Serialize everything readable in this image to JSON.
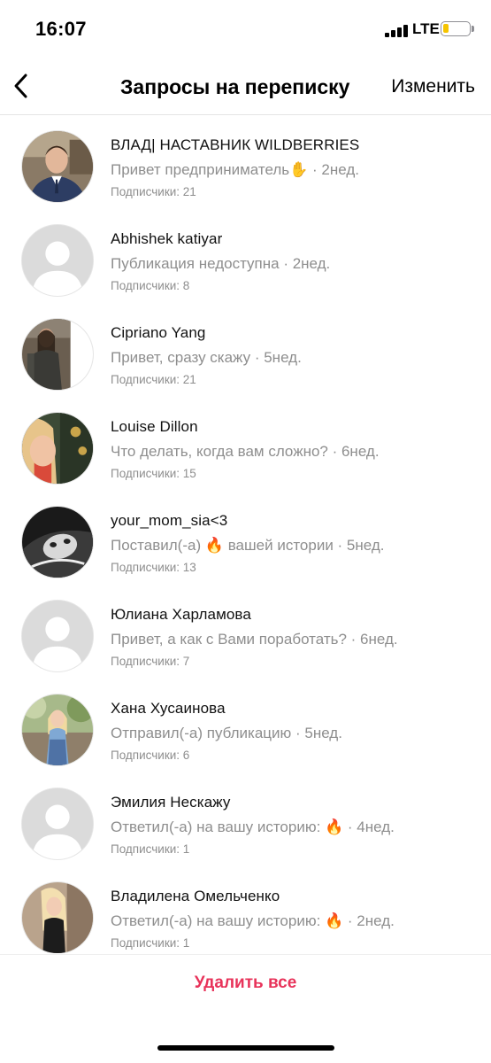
{
  "status_bar": {
    "time": "16:07",
    "network": "LTE",
    "battery_level": 0.2,
    "battery_color": "#f5c400"
  },
  "header": {
    "title": "Запросы на переписку",
    "edit_label": "Изменить",
    "back_icon": "chevron-left-icon"
  },
  "requests": [
    {
      "name": "ВЛАД| НАСТАВНИК WILDBERRIES",
      "preview": "Привет предприниматель✋",
      "time": " · 2нед.",
      "followers": "Подписчики: 21",
      "avatar": "photo"
    },
    {
      "name": "Abhishek katiyar",
      "preview": "Публикация недоступна",
      "time": " · 2нед.",
      "followers": "Подписчики: 8",
      "avatar": "default"
    },
    {
      "name": "Cipriano Yang",
      "preview": "Привет, сразу скажу",
      "time": " · 5нед.",
      "followers": "Подписчики: 21",
      "avatar": "photo"
    },
    {
      "name": "Louise Dillon",
      "preview": "Что делать, когда вам сложно?",
      "time": " · 6нед.",
      "followers": "Подписчики: 15",
      "avatar": "photo"
    },
    {
      "name": "your_mom_sia<3",
      "preview": "Поставил(-а) 🔥 вашей истории",
      "time": " · 5нед.",
      "followers": "Подписчики: 13",
      "avatar": "photo"
    },
    {
      "name": "Юлиана Харламова",
      "preview": "Привет, а как с Вами поработать?",
      "time": " · 6нед.",
      "followers": "Подписчики: 7",
      "avatar": "default"
    },
    {
      "name": "Хана Хусаинова",
      "preview": "Отправил(-а) публикацию",
      "time": " · 5нед.",
      "followers": "Подписчики: 6",
      "avatar": "photo"
    },
    {
      "name": "Эмилия Нескажу",
      "preview": "Ответил(-а) на вашу историю: 🔥",
      "time": " · 4нед.",
      "followers": "Подписчики: 1",
      "avatar": "default"
    },
    {
      "name": "Владилена Омельченко",
      "preview": "Ответил(-а) на вашу историю: 🔥",
      "time": " · 2нед.",
      "followers": "Подписчики: 1",
      "avatar": "photo"
    }
  ],
  "footer": {
    "delete_all_label": "Удалить все",
    "accent_color": "#e8335a"
  }
}
